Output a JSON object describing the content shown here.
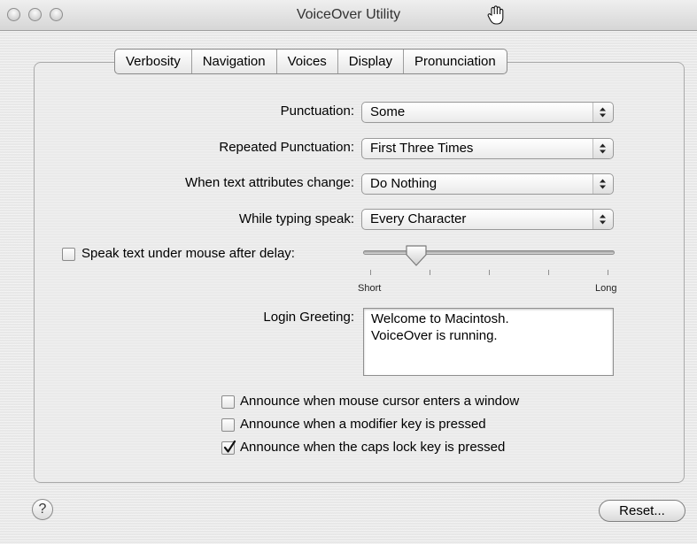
{
  "window": {
    "title": "VoiceOver Utility"
  },
  "tabs": [
    "Verbosity",
    "Navigation",
    "Voices",
    "Display",
    "Pronunciation"
  ],
  "settings": {
    "punctuation": {
      "label": "Punctuation:",
      "value": "Some"
    },
    "repeated_punctuation": {
      "label": "Repeated Punctuation:",
      "value": "First Three Times"
    },
    "text_attributes": {
      "label": "When text attributes change:",
      "value": "Do Nothing"
    },
    "typing_speak": {
      "label": "While typing speak:",
      "value": "Every Character"
    }
  },
  "speak_under_mouse": {
    "label": "Speak text under mouse after delay:",
    "checked": false
  },
  "slider": {
    "min_label": "Short",
    "max_label": "Long",
    "level_fraction": 0.2
  },
  "login_greeting": {
    "label": "Login Greeting:",
    "value": "Welcome to Macintosh.\nVoiceOver is running."
  },
  "announce": [
    {
      "label": "Announce when mouse cursor enters a window",
      "checked": false
    },
    {
      "label": "Announce when a modifier key is pressed",
      "checked": false
    },
    {
      "label": "Announce when the caps lock key is pressed",
      "checked": true
    }
  ],
  "buttons": {
    "help": "?",
    "reset": "Reset..."
  },
  "icons": [
    "close-icon",
    "minimize-icon",
    "zoom-icon",
    "hand-cursor-icon",
    "popup-arrows-icon",
    "checkmark-icon",
    "help-icon"
  ]
}
